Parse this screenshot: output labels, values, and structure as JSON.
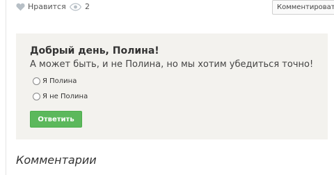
{
  "top_bar": {
    "like_label": "Нравится",
    "views_count": "2",
    "comment_button_label": "Комментировать"
  },
  "poll": {
    "greeting": "Добрый день, Полина!",
    "subtitle": "А может быть, и не Полина, но мы хотим убедиться точно!",
    "options": [
      {
        "label": "Я Полина",
        "selected": false
      },
      {
        "label": "Я не Полина",
        "selected": false
      }
    ],
    "submit_label": "Ответить"
  },
  "comments": {
    "heading": "Комментарии"
  },
  "colors": {
    "accent_green": "#5cb85c",
    "poll_background": "#f3f2ee",
    "icon_gray": "#b7bfc6"
  },
  "icons": [
    "heart-icon",
    "eye-icon"
  ]
}
